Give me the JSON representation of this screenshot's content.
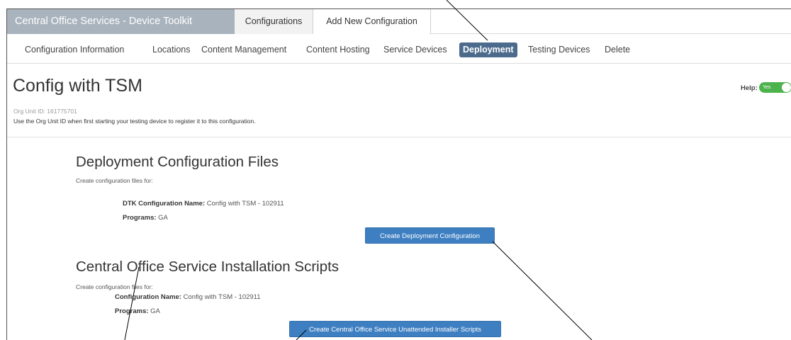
{
  "app": {
    "brand": "Central Office Services - Device Toolkit",
    "top_tabs": [
      {
        "label": "Configurations",
        "active": true
      },
      {
        "label": "Add New Configuration",
        "active": false
      }
    ]
  },
  "subnav": {
    "items": [
      {
        "label": "Configuration Information"
      },
      {
        "label": "Locations"
      },
      {
        "label": "Content Management"
      },
      {
        "label": "Content Hosting"
      },
      {
        "label": "Service Devices"
      },
      {
        "label": "Deployment",
        "active": true
      },
      {
        "label": "Testing Devices"
      },
      {
        "label": "Delete"
      }
    ],
    "active_color": "#4c6b8c"
  },
  "header": {
    "title": "Config with TSM",
    "org_unit_label": "Org Unit ID:",
    "org_unit_id": "161775701",
    "org_unit_help": "Use the Org Unit ID when first starting your testing device to register it to this configuration.",
    "help_label": "Help:",
    "help_toggle": "Yes",
    "help_toggle_color": "#4cb34c"
  },
  "deployment": {
    "title": "Deployment Configuration Files",
    "subtitle": "Create configuration files for:",
    "name_label": "DTK Configuration Name:",
    "name_value": "Config with TSM - 102911",
    "programs_label": "Programs:",
    "programs_value": "GA",
    "button": "Create Deployment Configuration"
  },
  "cos_scripts": {
    "title": "Central Office Service Installation Scripts",
    "subtitle": "Create configuration files for:",
    "name_label": "Configuration Name:",
    "name_value": "Config with TSM - 102911",
    "programs_label": "Programs:",
    "programs_value": "GA",
    "button": "Create Central Office Service Unattended Installer Scripts"
  },
  "colors": {
    "brand_bg": "#a9b3bd",
    "button_bg": "#3e7fc1"
  }
}
